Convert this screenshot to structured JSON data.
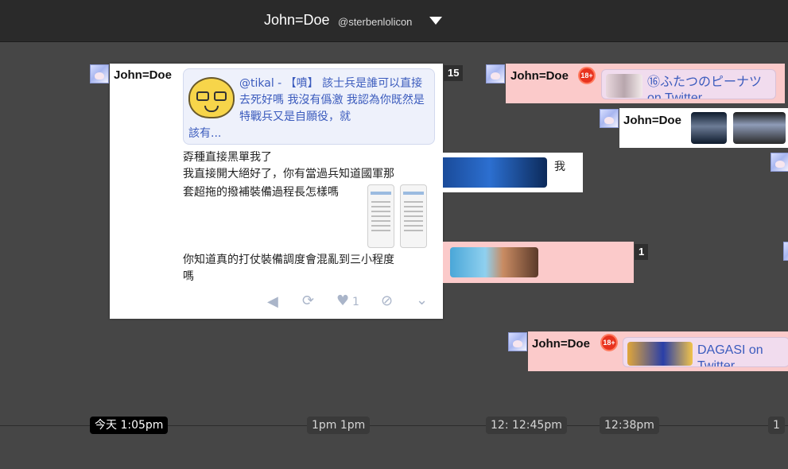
{
  "header": {
    "display_name": "John=Doe",
    "handle": "@sterbenlolicon"
  },
  "main_post": {
    "user": "John=Doe",
    "count": "15",
    "quote_line1": "@tikal - 【噴】 該士兵是誰可以直接去死好嗎 我沒有僞激 我認為你既然是特戰兵又是自願役，就",
    "quote_line2": "該有...",
    "body_lines": [
      "孬種直接黑單我了",
      "我直接開大絕好了，你有當過兵知道國軍那",
      "套超拖的撥補裝備過程長怎樣嗎"
    ],
    "body_tail": [
      "你知道真的打仗裝備調度會混亂到三小程度",
      "嗎"
    ],
    "actions": {
      "mute": "mute-icon",
      "retweet": "retweet-icon",
      "like": "heart-icon",
      "like_count": "1",
      "block": "block-icon",
      "more": "chevron-down-icon"
    }
  },
  "posts": {
    "p1": {
      "user": "John=Doe",
      "badge": "18+",
      "link": "⑯ふたつのピーナツ",
      "link2": "on Twitter"
    },
    "p2": {
      "user": "John=Doe"
    },
    "p3": {
      "text": "我"
    },
    "p4": {
      "count": "1"
    },
    "p5": {
      "user": "John=Doe",
      "badge": "18+",
      "link": "DAGASI on",
      "link2": "Twitter"
    }
  },
  "timeline": {
    "ticks": [
      "今天 1:05pm",
      "1pm 1pm",
      "12: 12:45pm",
      "12:38pm",
      "1"
    ]
  },
  "colors": {
    "pink": "#fbcaca",
    "link": "#3b5bbd",
    "badge": "#e8321e"
  }
}
